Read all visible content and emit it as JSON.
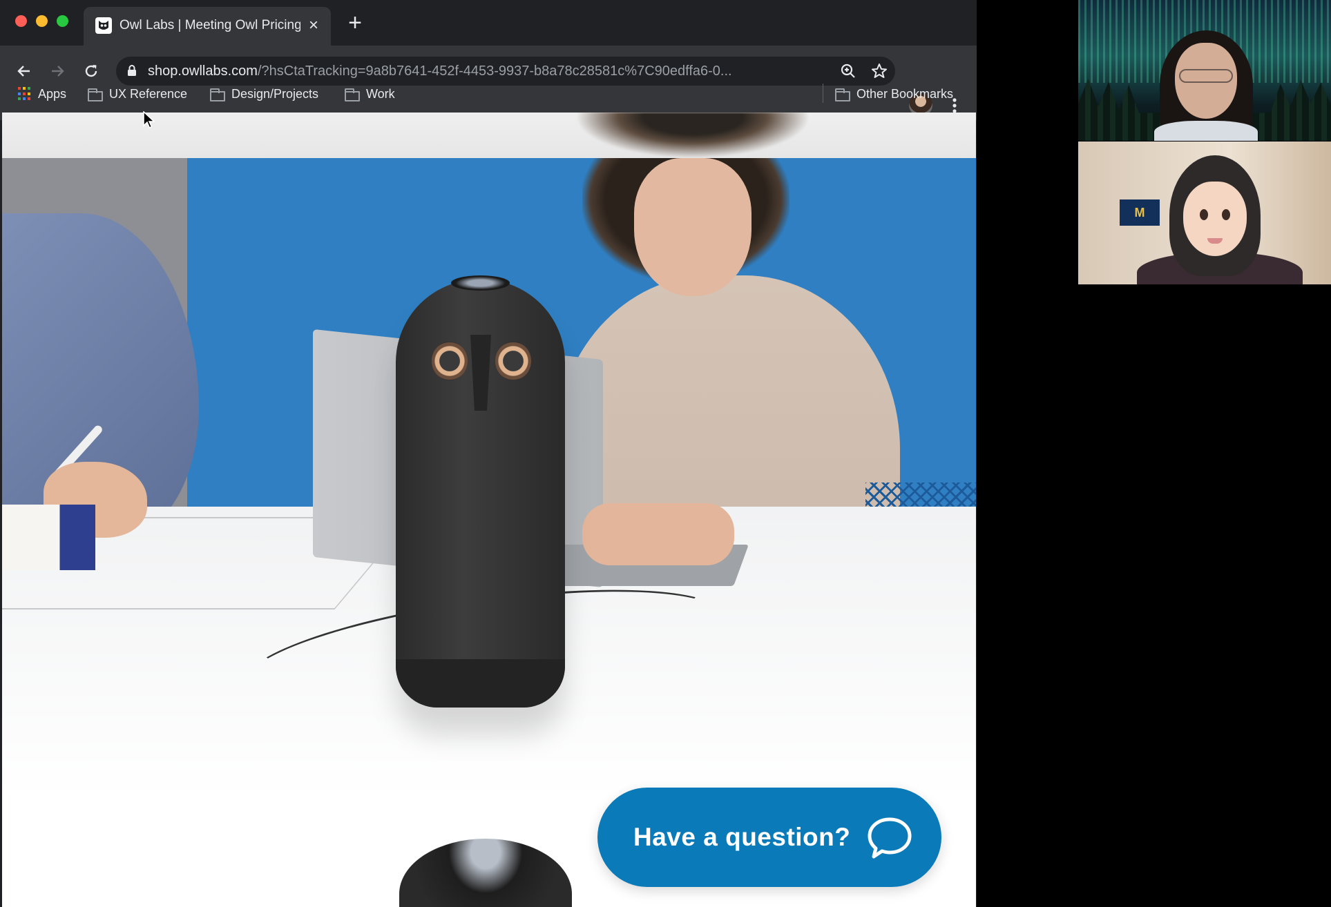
{
  "browser": {
    "traffic_lights": {
      "close": "#ff5f57",
      "minimize": "#febc2e",
      "maximize": "#28c840"
    },
    "tab": {
      "title": "Owl Labs | Meeting Owl Pricing",
      "favicon": "owl-labs-favicon",
      "close_icon": "×"
    },
    "new_tab_icon": "+",
    "address_bar": {
      "host": "shop.owllabs.com",
      "path": "/?hsCtaTracking=9a8b7641-452f-4453-9937-b8a78c28581c%7C90edffa6-0..."
    },
    "bookmarks": [
      {
        "label": "Apps",
        "icon": "apps-grid-icon"
      },
      {
        "label": "UX Reference",
        "icon": "folder-icon"
      },
      {
        "label": "Design/Projects",
        "icon": "folder-icon"
      },
      {
        "label": "Work",
        "icon": "folder-icon"
      }
    ],
    "other_bookmarks": "Other Bookmarks"
  },
  "page": {
    "chat_button_label": "Have a question?",
    "chat_button_color": "#0a7ab8"
  },
  "video_call": {
    "participants": [
      {
        "type": "camera",
        "background": "aurora-forest"
      },
      {
        "type": "avatar-emoji",
        "flag_text": "M"
      }
    ]
  }
}
